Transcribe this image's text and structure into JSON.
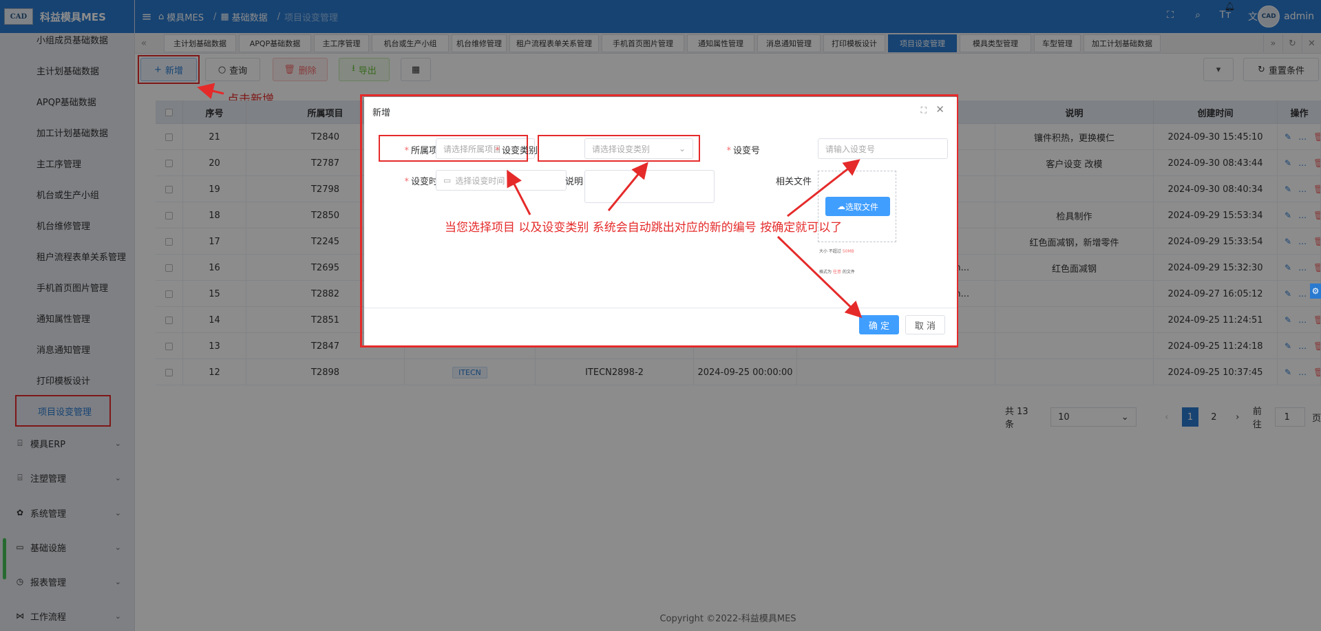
{
  "app": {
    "name": "科益模具MES",
    "logo_badge": "CAD"
  },
  "header": {
    "breadcrumb": [
      "模具MES",
      "基础数据",
      "项目设变管理"
    ],
    "avatar_text": "CAD",
    "username": "admin"
  },
  "sidebar": {
    "items": [
      "小组成员基础数据",
      "主计划基础数据",
      "APQP基础数据",
      "加工计划基础数据",
      "主工序管理",
      "机台或生产小组",
      "机台维修管理",
      "租户流程表单关系管理",
      "手机首页图片管理",
      "通知属性管理",
      "消息通知管理",
      "打印模板设计",
      "项目设变管理"
    ],
    "groups": [
      "模具ERP",
      "注塑管理",
      "系统管理",
      "基础设施",
      "报表管理",
      "工作流程"
    ]
  },
  "tabs": [
    "主计划基础数据",
    "APQP基础数据",
    "主工序管理",
    "机台或生产小组",
    "机台维修管理",
    "租户流程表单关系管理",
    "手机首页图片管理",
    "通知属性管理",
    "消息通知管理",
    "打印模板设计",
    "项目设变管理",
    "模具类型管理",
    "车型管理",
    "加工计划基础数据"
  ],
  "toolbar": {
    "add": "新增",
    "query": "查询",
    "delete": "删除",
    "export": "导出",
    "reset": "重置条件"
  },
  "table": {
    "columns": [
      "序号",
      "所属项目",
      "说明",
      "创建时间",
      "操作"
    ],
    "rows": [
      {
        "seq": "21",
        "project": "T2840",
        "mid": "",
        "note": "镶件积热，更换模仁",
        "created": "2024-09-30 15:45:10"
      },
      {
        "seq": "20",
        "project": "T2787",
        "mid": "",
        "note": "客户设变 改模",
        "created": "2024-09-30 08:43:44"
      },
      {
        "seq": "19",
        "project": "T2798",
        "mid": "",
        "note": "",
        "created": "2024-09-30 08:40:34"
      },
      {
        "seq": "18",
        "project": "T2850",
        "mid": "",
        "note": "检具制作",
        "created": "2024-09-29 15:53:34"
      },
      {
        "seq": "17",
        "project": "T2245",
        "mid": "",
        "note": "红色面减钢，新增零件",
        "created": "2024-09-29 15:33:54"
      },
      {
        "seq": "16",
        "project": "T2695",
        "mid": "dmin...",
        "note": "红色面减钢",
        "created": "2024-09-29 15:32:30"
      },
      {
        "seq": "15",
        "project": "T2882",
        "mid": "dmin...",
        "note": "",
        "created": "2024-09-27 16:05:12"
      },
      {
        "seq": "14",
        "project": "T2851",
        "mid": "",
        "note": "",
        "created": "2024-09-25 11:24:51"
      },
      {
        "seq": "13",
        "project": "T2847",
        "mid": "",
        "note": "",
        "created": "2024-09-25 11:24:18"
      },
      {
        "seq": "12",
        "project": "T2898",
        "tag": "ITECN",
        "change_no": "ITECN2898-2",
        "change_time": "2024-09-25 00:00:00",
        "mid": "",
        "note": "",
        "created": "2024-09-25 10:37:45"
      }
    ]
  },
  "pagination": {
    "total": "共 13 条",
    "page_size": "10",
    "pages": [
      "1",
      "2"
    ],
    "goto_label": "前往",
    "goto_value": "1",
    "page_suffix": "页"
  },
  "footer": "Copyright ©2022-科益模具MES",
  "dialog": {
    "title": "新增",
    "fields": {
      "project": {
        "label": "所属项目",
        "placeholder": "请选择所属项目"
      },
      "change_type": {
        "label": "设变类别",
        "placeholder": "请选择设变类别"
      },
      "change_no": {
        "label": "设变号",
        "placeholder": "请输入设变号"
      },
      "change_time": {
        "label": "设变时间",
        "placeholder": "选择设变时间"
      },
      "description": {
        "label": "说明"
      },
      "files": {
        "label": "相关文件",
        "button": "选取文件",
        "hint_size_prefix": "大小 不超过",
        "hint_size_value": "50MB",
        "hint_fmt_prefix": "格式为",
        "hint_fmt_value": "任意",
        "hint_fmt_suffix": "的文件"
      }
    },
    "confirm": "确 定",
    "cancel": "取 消"
  },
  "annotations": {
    "click_add": "点击新增",
    "instruction": "当您选择项目 以及设变类别 系统会自动跳出对应的新的编号 按确定就可以了"
  },
  "colors": {
    "primary": "#2a7ad0",
    "annotation": "#e52a2a",
    "button_blue": "#409eff"
  }
}
